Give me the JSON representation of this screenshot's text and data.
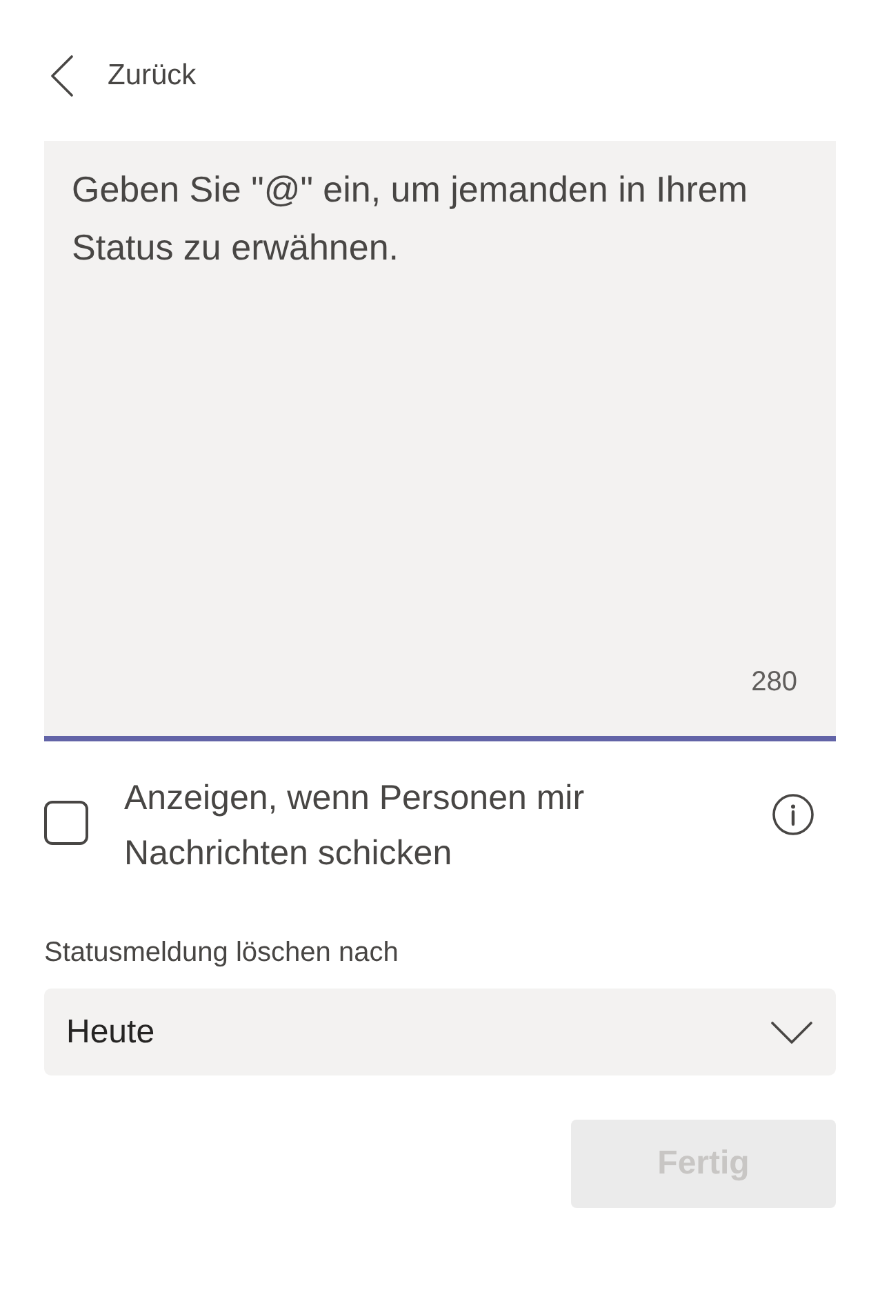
{
  "back": {
    "label": "Zurück"
  },
  "status_message": {
    "placeholder": "Geben Sie \"@\" ein, um jemanden in Ihrem Status zu erwähnen.",
    "char_count": "280",
    "focused": true
  },
  "show_when_messaged": {
    "label": "Anzeigen, wenn Personen mir Nachrichten schicken",
    "checked": false
  },
  "clear_after": {
    "label": "Statusmeldung löschen nach",
    "value": "Heute"
  },
  "done_button": {
    "label": "Fertig",
    "disabled": true
  }
}
